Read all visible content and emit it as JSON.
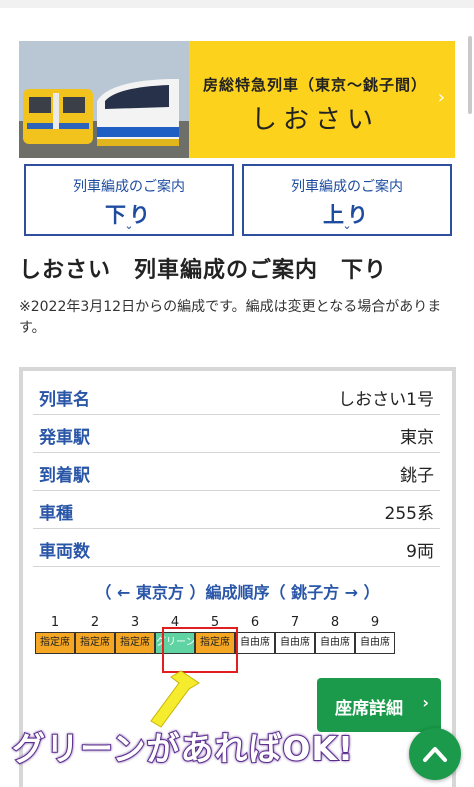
{
  "banner": {
    "subtitle": "房総特急列車（東京～銚子間）",
    "title": "しおさい",
    "arrow": "›"
  },
  "direction_buttons": [
    {
      "label": "列車編成のご案内",
      "direction": "下り",
      "chevron": "⌄"
    },
    {
      "label": "列車編成のご案内",
      "direction": "上り",
      "chevron": "⌄"
    }
  ],
  "page_title": "しおさい　列車編成のご案内　下り",
  "note": "※2022年3月12日からの編成です。編成は変更となる場合があります。",
  "train_info": [
    {
      "label": "列車名",
      "value": "しおさい1号"
    },
    {
      "label": "発車駅",
      "value": "東京"
    },
    {
      "label": "到着駅",
      "value": "銚子"
    },
    {
      "label": "車種",
      "value": "255系"
    },
    {
      "label": "車両数",
      "value": "9両"
    }
  ],
  "order_label": "（ ← 東京方 ）編成順序（ 銚子方 → ）",
  "cars": [
    {
      "number": "1",
      "seat": "指定席",
      "type": "reserved"
    },
    {
      "number": "2",
      "seat": "指定席",
      "type": "reserved"
    },
    {
      "number": "3",
      "seat": "指定席",
      "type": "reserved"
    },
    {
      "number": "4",
      "seat": "グリーン",
      "type": "green"
    },
    {
      "number": "5",
      "seat": "指定席",
      "type": "reserved"
    },
    {
      "number": "6",
      "seat": "自由席",
      "type": "free"
    },
    {
      "number": "7",
      "seat": "自由席",
      "type": "free"
    },
    {
      "number": "8",
      "seat": "自由席",
      "type": "free"
    },
    {
      "number": "9",
      "seat": "自由席",
      "type": "free"
    }
  ],
  "seat_detail_button": {
    "label": "座席詳細",
    "arrow": "›"
  },
  "caption": "グリーンがあればOK!",
  "colors": {
    "banner": "#fcd21c",
    "accent_blue": "#2a56a8",
    "reserved": "#f5a623",
    "green_car": "#5fd3a1",
    "button_green": "#1a9a4a",
    "highlight": "#e02020",
    "arrow": "#f5ec2e"
  },
  "icons": [
    "train-photo-icon",
    "chevron-right-icon",
    "chevron-down-icon",
    "arrow-up-icon",
    "highlight-arrow-icon"
  ]
}
